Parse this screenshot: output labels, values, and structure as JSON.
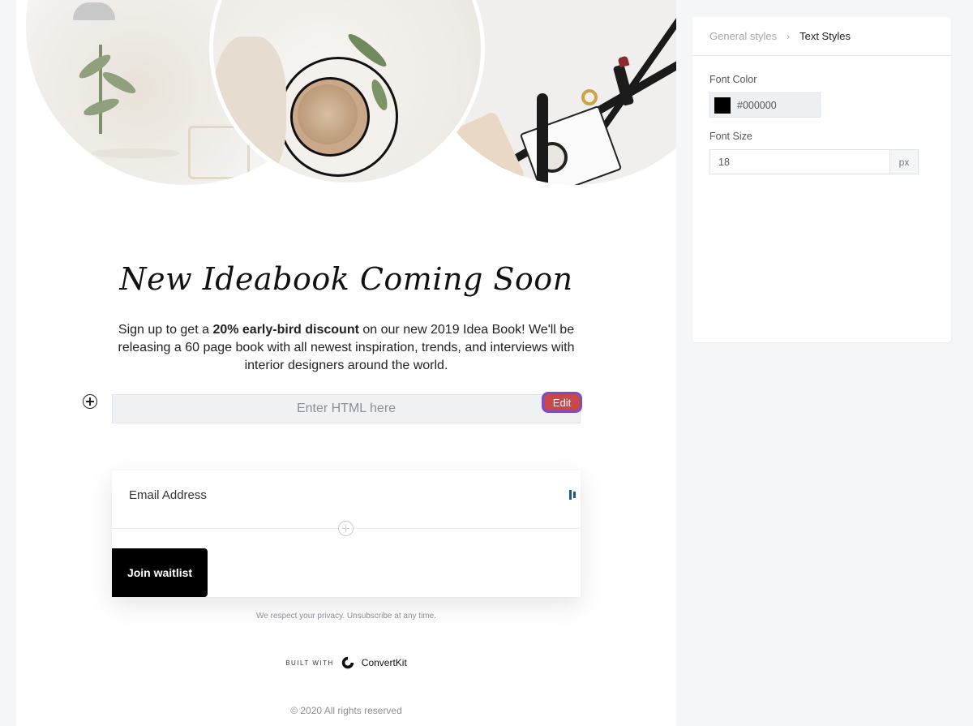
{
  "page": {
    "headline": "New Ideabook Coming Soon",
    "intro": {
      "before": "Sign up to get a ",
      "bold": "20% early-bird discount",
      "after": " on our new 2019 Idea Book! We'll be releasing a 60 page book with all newest inspiration, trends, and interviews with interior designers around the world."
    },
    "html_block": {
      "placeholder": "Enter HTML here",
      "edit_label": "Edit"
    },
    "form": {
      "email_label": "Email Address",
      "submit_label": "Join waitlist",
      "privacy": "We respect your privacy. Unsubscribe at any time."
    },
    "footer": {
      "built_with": "BUILT WITH",
      "brand": "ConvertKit",
      "copyright": "© 2020 All rights reserved"
    }
  },
  "panel": {
    "breadcrumb": {
      "parent": "General styles",
      "current": "Text Styles"
    },
    "font_color": {
      "label": "Font Color",
      "value": "#000000"
    },
    "font_size": {
      "label": "Font Size",
      "value": "18",
      "unit": "px"
    }
  },
  "icons": [
    "add-block-icon",
    "field-settings-icon",
    "add-field-icon",
    "chevron-right-icon",
    "convertkit-logo-icon"
  ],
  "colors": {
    "accent_edit": "#c9474a",
    "edit_outline": "#7a4fc2",
    "button": "#000000",
    "swatch": "#000000"
  }
}
